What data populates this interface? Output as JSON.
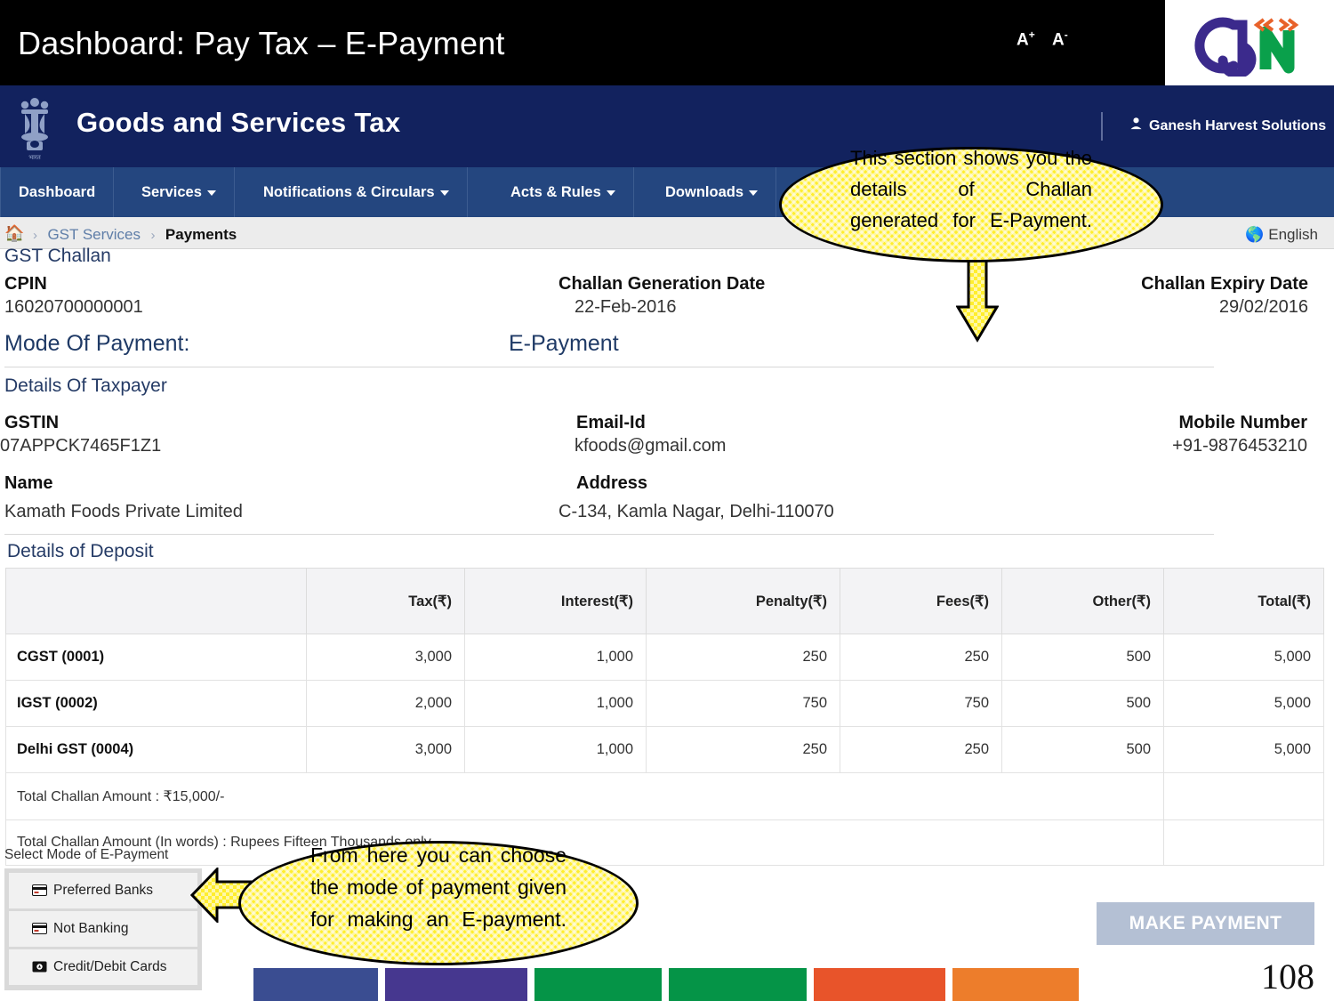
{
  "slide": {
    "title": "Dashboard: Pay Tax – E-Payment",
    "page_number": "108",
    "logo_alt": "gstn-logo"
  },
  "portal": {
    "emblem_alt": "india-national-emblem",
    "title": "Goods and Services Tax",
    "font_increase": "A",
    "font_increase_sign": "+",
    "font_decrease": "A",
    "font_decrease_sign": "-",
    "user_name": "Ganesh Harvest Solutions",
    "nav": [
      {
        "label": "Dashboard",
        "has_caret": false
      },
      {
        "label": "Services",
        "has_caret": true
      },
      {
        "label": "Notifications & Circulars",
        "has_caret": true
      },
      {
        "label": "Acts & Rules",
        "has_caret": true
      },
      {
        "label": "Downloads",
        "has_caret": true
      }
    ]
  },
  "breadcrumb": {
    "home_icon": "home-icon",
    "items": [
      "GST Services",
      "Payments"
    ],
    "language": "English",
    "language_icon": "globe-icon"
  },
  "challan": {
    "section_title": "GST Challan",
    "cpin_label": "CPIN",
    "cpin_value": "16020700000001",
    "gen_date_label": "Challan Generation Date",
    "gen_date_value": "22-Feb-2016",
    "expiry_label": "Challan Expiry Date",
    "expiry_value": "29/02/2016",
    "mode_label": "Mode Of Payment:",
    "mode_value": "E-Payment"
  },
  "taxpayer": {
    "section_title": "Details Of Taxpayer",
    "gstin_label": "GSTIN",
    "gstin_value": "07APPCK7465F1Z1",
    "email_label": "Email-Id",
    "email_value": "kfoods@gmail.com",
    "mobile_label": "Mobile Number",
    "mobile_value": "+91-9876453210",
    "name_label": "Name",
    "name_value": "Kamath Foods Private Limited",
    "address_label": "Address",
    "address_value": "C-134, Kamla Nagar, Delhi-110070"
  },
  "deposit": {
    "section_title": "Details of Deposit",
    "columns": [
      "",
      "Tax(₹)",
      "Interest(₹)",
      "Penalty(₹)",
      "Fees(₹)",
      "Other(₹)",
      "Total(₹)"
    ],
    "rows": [
      {
        "label": "CGST (0001)",
        "tax": "3,000",
        "interest": "1,000",
        "penalty": "250",
        "fees": "250",
        "other": "500",
        "total": "5,000"
      },
      {
        "label": "IGST (0002)",
        "tax": "2,000",
        "interest": "1,000",
        "penalty": "750",
        "fees": "750",
        "other": "500",
        "total": "5,000"
      },
      {
        "label": "Delhi GST (0004)",
        "tax": "3,000",
        "interest": "1,000",
        "penalty": "250",
        "fees": "250",
        "other": "500",
        "total": "5,000"
      }
    ],
    "total_amount_text": "Total Challan Amount : ₹15,000/-",
    "total_words_text": "Total Challan Amount (In words) : Rupees Fifteen Thousands only"
  },
  "payment_modes": {
    "label": "Select Mode of E-Payment",
    "items": [
      {
        "label": "Preferred Banks",
        "icon": "card-icon"
      },
      {
        "label": "Not Banking",
        "icon": "card-icon"
      },
      {
        "label": "Credit/Debit Cards",
        "icon": "credit-card-icon"
      }
    ],
    "make_payment_label": "MAKE PAYMENT"
  },
  "callouts": [
    {
      "id": "callout-challan-details",
      "text": "This section shows you the details of Challan generated for E-Payment.",
      "arrow": "down"
    },
    {
      "id": "callout-payment-mode",
      "text": "From here you can choose the mode of payment given for making an E-payment.",
      "arrow": "left"
    }
  ],
  "bottom_blocks": [
    {
      "color": "#3a4d91"
    },
    {
      "color": "#46378f"
    },
    {
      "color": "#059447"
    },
    {
      "color": "#059447"
    },
    {
      "color": "#e8542a"
    },
    {
      "color": "#ed7d2b"
    }
  ]
}
